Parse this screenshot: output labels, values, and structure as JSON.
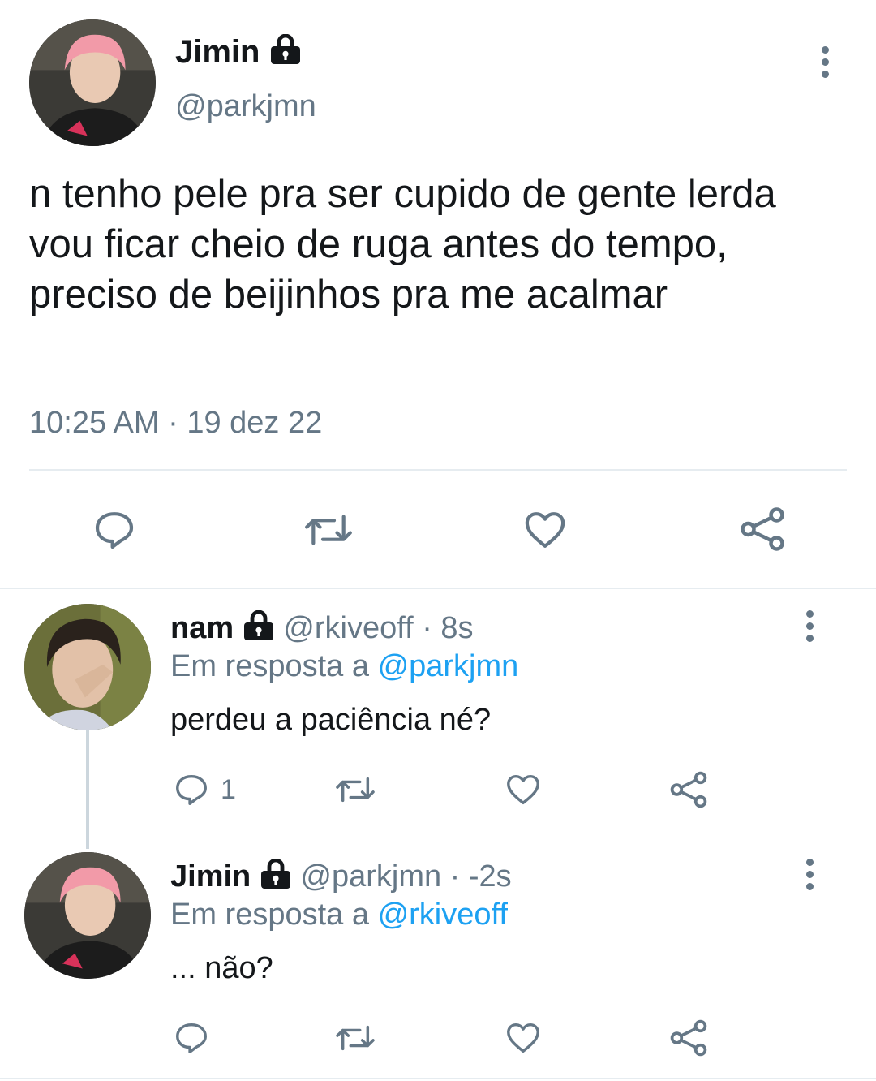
{
  "main_tweet": {
    "display_name": "Jimin",
    "handle": "@parkjmn",
    "text": "n tenho pele pra ser cupido de gente lerda vou ficar cheio de ruga antes do tempo, preciso de beijinhos pra me acalmar",
    "timestamp": "10:25 AM · 19 dez 22"
  },
  "replies": [
    {
      "display_name": "nam",
      "handle": "@rkiveoff",
      "time": "· 8s",
      "reply_prefix": "Em resposta a",
      "reply_to": "@parkjmn",
      "text": "perdeu a paciência né?",
      "reply_count": "1"
    },
    {
      "display_name": "Jimin",
      "handle": "@parkjmn",
      "time": "· -2s",
      "reply_prefix": "Em resposta a",
      "reply_to": "@rkiveoff",
      "text": "... não?",
      "reply_count": ""
    }
  ],
  "colors": {
    "text": "#14171a",
    "secondary": "#657786",
    "link": "#1da1f2",
    "divider": "#e6ecf0",
    "icon": "#657786"
  },
  "icons": [
    "lock-icon",
    "more-options-icon",
    "reply-icon",
    "retweet-icon",
    "like-icon",
    "share-icon"
  ]
}
